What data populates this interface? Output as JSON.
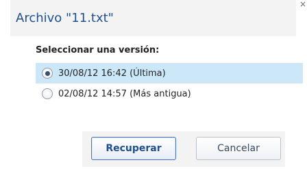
{
  "dialog": {
    "title": "Archivo \"11.txt\"",
    "close_glyph": "×",
    "section_label": "Seleccionar una versión:",
    "options": [
      {
        "label": "30/08/12 16:42 (Última)",
        "selected": true
      },
      {
        "label": "02/08/12 14:57 (Más antigua)",
        "selected": false
      }
    ],
    "buttons": {
      "recover": "Recuperar",
      "cancel": "Cancelar"
    }
  },
  "colors": {
    "title": "#1f4f8d",
    "selected_row": "#cce8f8",
    "panel_bg": "#f3f3f3",
    "primary_border": "#4a78b7"
  }
}
